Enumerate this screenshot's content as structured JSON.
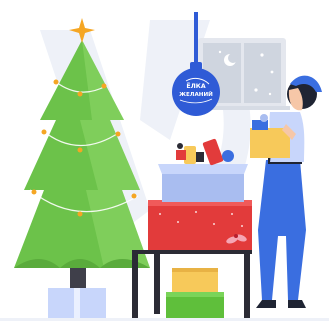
{
  "bauble": {
    "line1": "ЁЛКА",
    "line2": "ЖЕЛАНИЙ"
  },
  "colors": {
    "background": "#ffffff",
    "watermark": "#eef1f8",
    "tree_green": "#6cc24a",
    "tree_light": "#8fd86a",
    "star": "#f5a623",
    "bauble_blue": "#2f5bd6",
    "box_blue": "#a9bdf0",
    "table_red": "#e23b3b",
    "gift_yellow": "#f7c95a",
    "gift_green": "#5fbf3b",
    "outfit_blue": "#3a6ee0",
    "hair": "#1f2433"
  },
  "icons": [
    "star-icon",
    "moon-icon",
    "snowflake-icon"
  ]
}
